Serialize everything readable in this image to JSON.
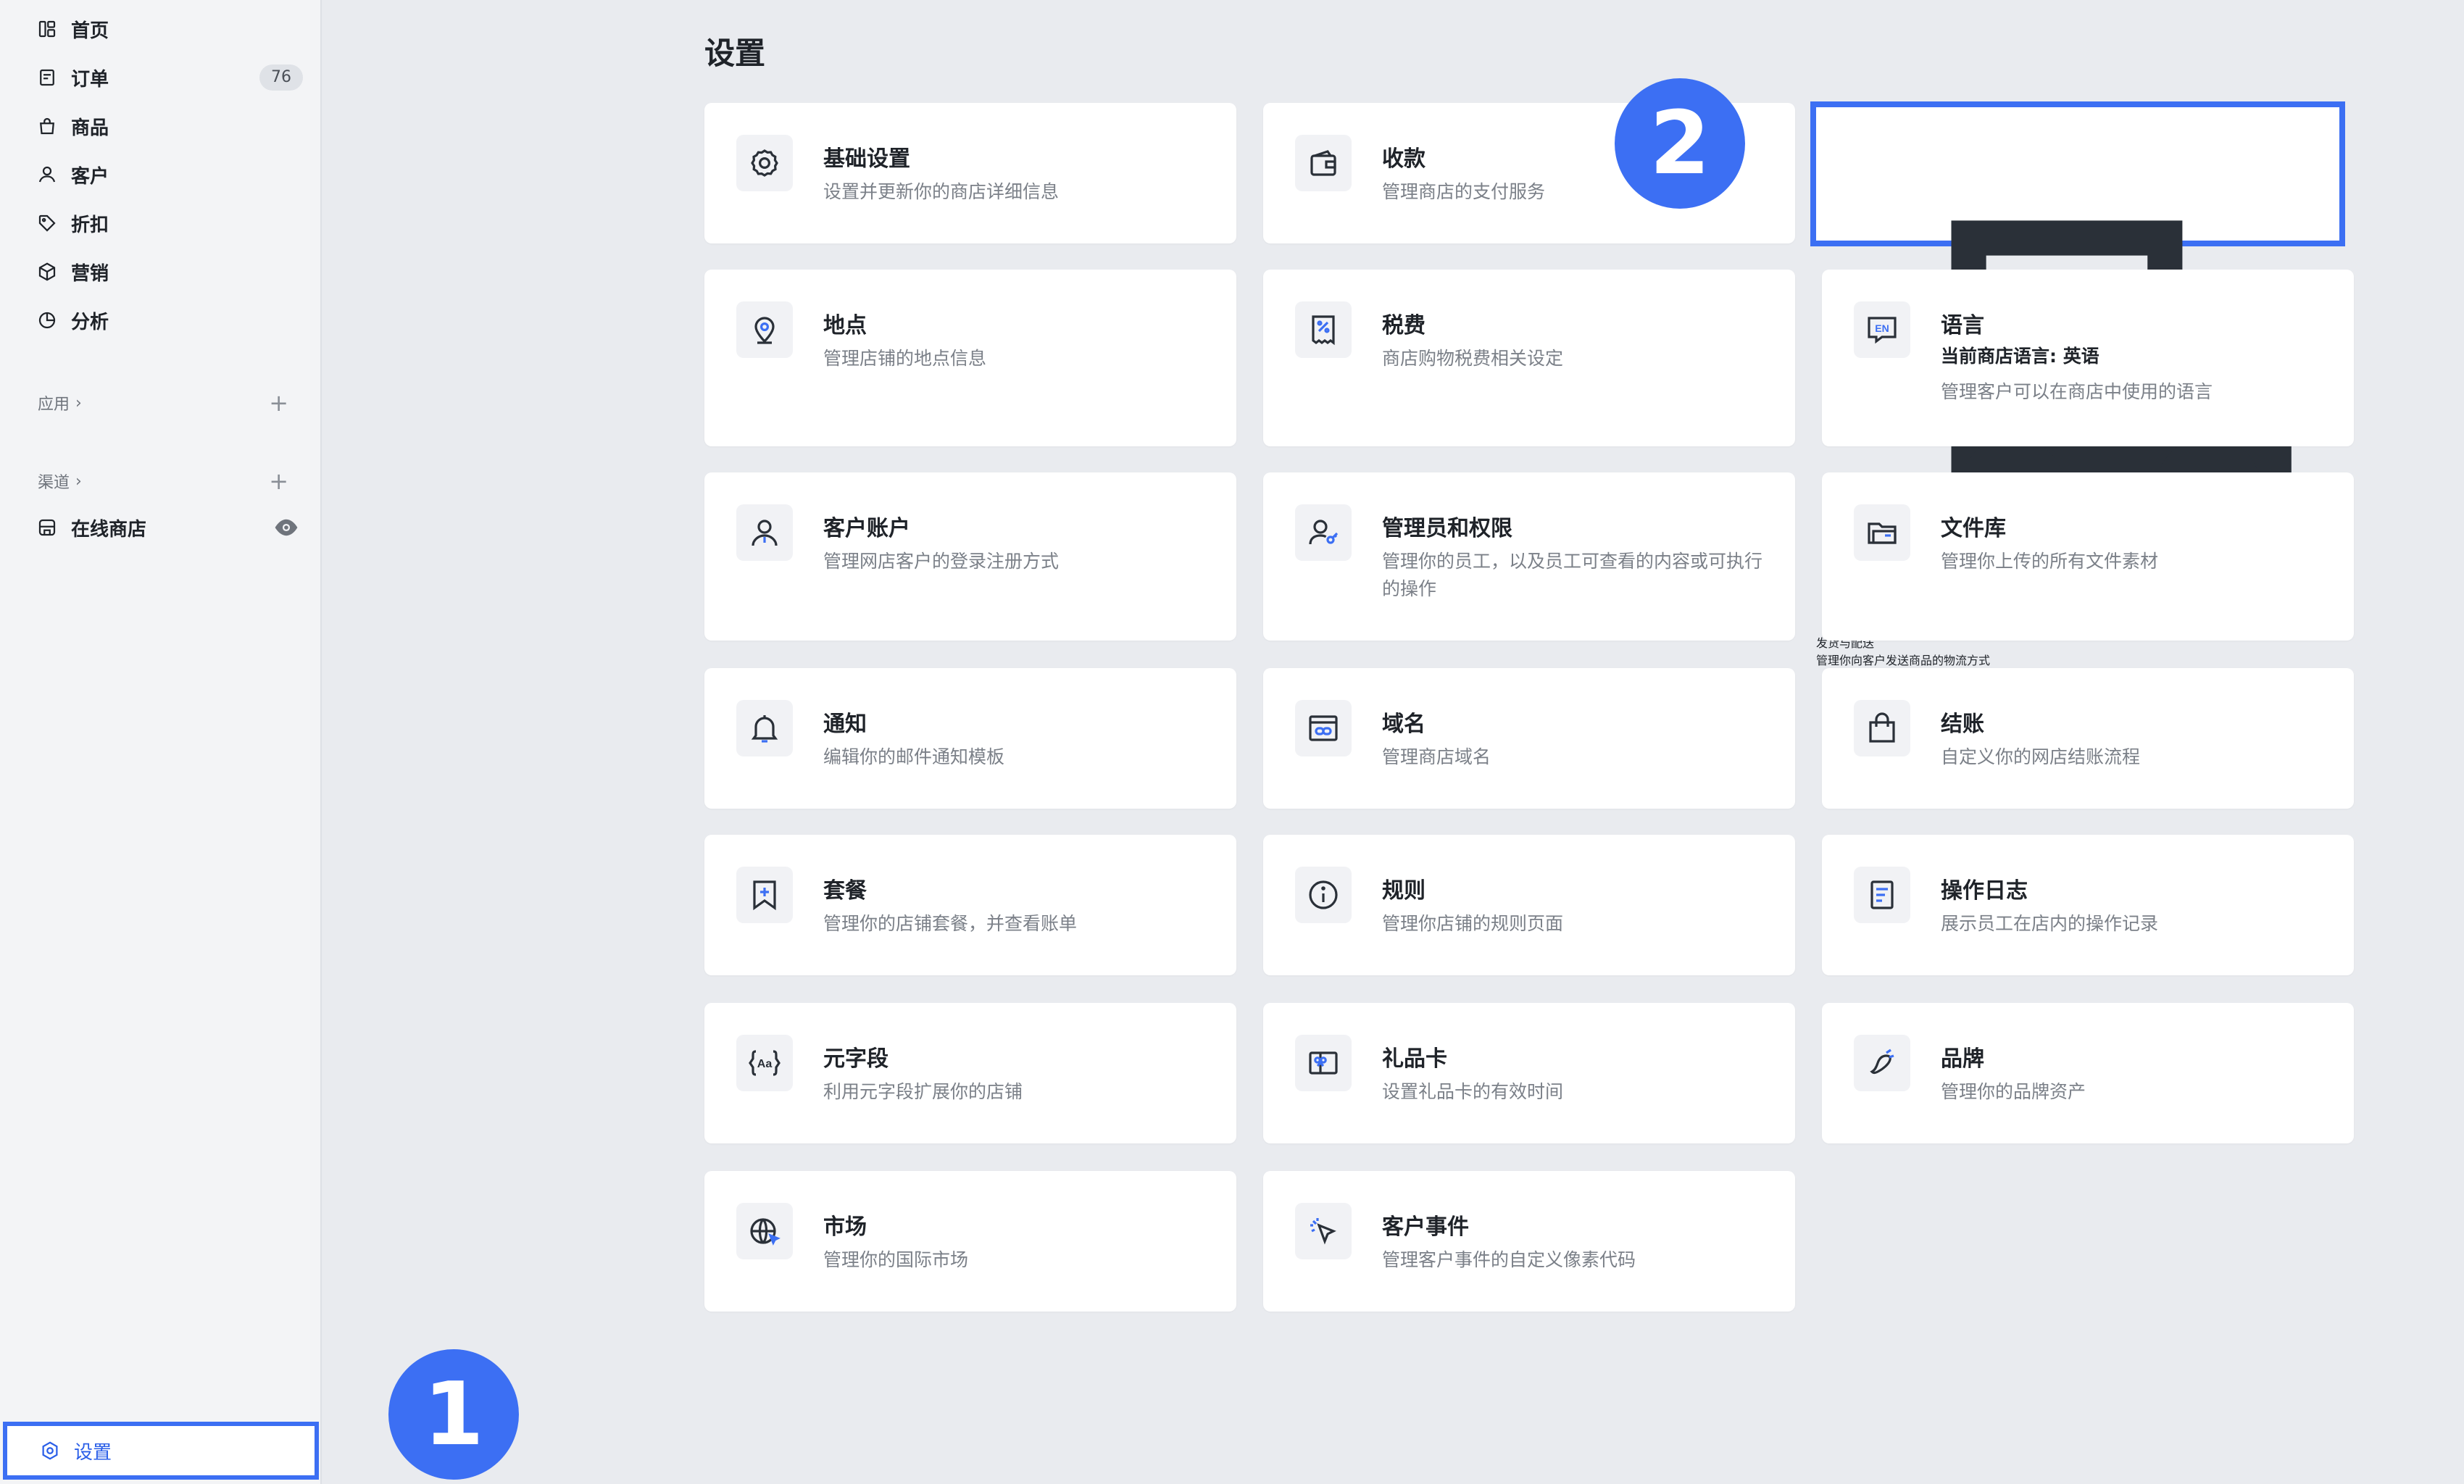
{
  "sidebar": {
    "items": [
      {
        "label": "首页",
        "icon": "home-icon"
      },
      {
        "label": "订单",
        "icon": "orders-icon",
        "badge": "76"
      },
      {
        "label": "商品",
        "icon": "bag-icon"
      },
      {
        "label": "客户",
        "icon": "user-icon"
      },
      {
        "label": "折扣",
        "icon": "tag-icon"
      },
      {
        "label": "营销",
        "icon": "box-icon"
      },
      {
        "label": "分析",
        "icon": "chart-icon"
      }
    ],
    "apps_label": "应用",
    "channels_label": "渠道",
    "chevron": "›",
    "plus": "+",
    "online_store": "在线商店",
    "settings": "设置"
  },
  "main": {
    "title": "设置",
    "cards": [
      {
        "title": "基础设置",
        "desc": "设置并更新你的商店详细信息",
        "icon": "gear-icon"
      },
      {
        "title": "收款",
        "desc": "管理商店的支付服务",
        "icon": "wallet-icon"
      },
      {
        "title": "发货与配送",
        "desc": "管理你向客户发送商品的物流方式",
        "icon": "truck-icon"
      },
      {
        "title": "地点",
        "desc": "管理店铺的地点信息",
        "icon": "location-icon"
      },
      {
        "title": "税费",
        "desc": "商店购物税费相关设定",
        "icon": "receipt-icon"
      },
      {
        "title": "语言",
        "sub": "当前商店语言: 英语",
        "desc": "管理客户可以在商店中使用的语言",
        "icon": "language-icon"
      },
      {
        "title": "客户账户",
        "desc": "管理网店客户的登录注册方式",
        "icon": "customer-account-icon"
      },
      {
        "title": "管理员和权限",
        "desc": "管理你的员工，以及员工可查看的内容或可执行的操作",
        "icon": "staff-key-icon"
      },
      {
        "title": "文件库",
        "desc": "管理你上传的所有文件素材",
        "icon": "folder-icon"
      },
      {
        "title": "通知",
        "desc": "编辑你的邮件通知模板",
        "icon": "bell-icon"
      },
      {
        "title": "域名",
        "desc": "管理商店域名",
        "icon": "domain-link-icon"
      },
      {
        "title": "结账",
        "desc": "自定义你的网店结账流程",
        "icon": "shopping-bag-icon"
      },
      {
        "title": "套餐",
        "desc": "管理你的店铺套餐，并查看账单",
        "icon": "plan-bookmark-icon"
      },
      {
        "title": "规则",
        "desc": "管理你店铺的规则页面",
        "icon": "info-icon"
      },
      {
        "title": "操作日志",
        "desc": "展示员工在店内的操作记录",
        "icon": "log-icon"
      },
      {
        "title": "元字段",
        "desc": "利用元字段扩展你的店铺",
        "icon": "metafield-icon"
      },
      {
        "title": "礼品卡",
        "desc": "设置礼品卡的有效时间",
        "icon": "gift-card-icon"
      },
      {
        "title": "品牌",
        "desc": "管理你的品牌资产",
        "icon": "brand-icon"
      },
      {
        "title": "市场",
        "desc": "管理你的国际市场",
        "icon": "globe-icon"
      },
      {
        "title": "客户事件",
        "desc": "管理客户事件的自定义像素代码",
        "icon": "cursor-click-icon"
      }
    ]
  },
  "markers": {
    "one": "1",
    "two": "2"
  },
  "colors": {
    "accent": "#3c6ff3",
    "sidebar_bg": "#f3f4f6",
    "page_bg": "#e9ebef"
  }
}
